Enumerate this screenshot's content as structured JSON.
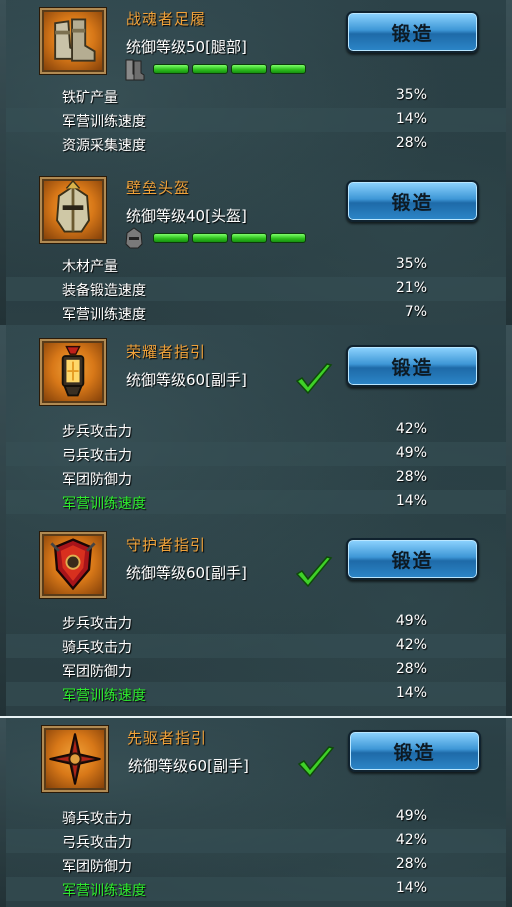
{
  "forge_button_label": "锻造",
  "items": [
    {
      "name": "战魂者足履",
      "level": "统御等级50[腿部]",
      "icon": "boots-icon",
      "slot_icon": "boot-slot-icon",
      "progress_segments": 4,
      "stats": [
        {
          "name": "铁矿产量",
          "value": "35%"
        },
        {
          "name": "军营训练速度",
          "value": "14%"
        },
        {
          "name": "资源采集速度",
          "value": "28%"
        }
      ]
    },
    {
      "name": "壁垒头盔",
      "level": "统御等级40[头盔]",
      "icon": "helmet-icon",
      "slot_icon": "helmet-slot-icon",
      "progress_segments": 4,
      "stats": [
        {
          "name": "木材产量",
          "value": "35%"
        },
        {
          "name": "装备锻造速度",
          "value": "21%"
        },
        {
          "name": "军营训练速度",
          "value": "7%"
        }
      ]
    },
    {
      "name": "荣耀者指引",
      "level": "统御等级60[副手]",
      "icon": "lantern-icon",
      "checked": true,
      "stats": [
        {
          "name": "步兵攻击力",
          "value": "42%"
        },
        {
          "name": "弓兵攻击力",
          "value": "49%"
        },
        {
          "name": "军团防御力",
          "value": "28%"
        },
        {
          "name": "军营训练速度",
          "value": "14%",
          "highlight": true
        }
      ]
    },
    {
      "name": "守护者指引",
      "level": "统御等级60[副手]",
      "icon": "shield-icon",
      "checked": true,
      "stats": [
        {
          "name": "步兵攻击力",
          "value": "49%"
        },
        {
          "name": "骑兵攻击力",
          "value": "42%"
        },
        {
          "name": "军团防御力",
          "value": "28%"
        },
        {
          "name": "军营训练速度",
          "value": "14%",
          "highlight": true
        }
      ]
    },
    {
      "name": "先驱者指引",
      "level": "统御等级60[副手]",
      "icon": "shuriken-icon",
      "checked": true,
      "stats": [
        {
          "name": "骑兵攻击力",
          "value": "49%"
        },
        {
          "name": "弓兵攻击力",
          "value": "42%"
        },
        {
          "name": "军团防御力",
          "value": "28%"
        },
        {
          "name": "军营训练速度",
          "value": "14%",
          "highlight": true
        }
      ]
    }
  ]
}
